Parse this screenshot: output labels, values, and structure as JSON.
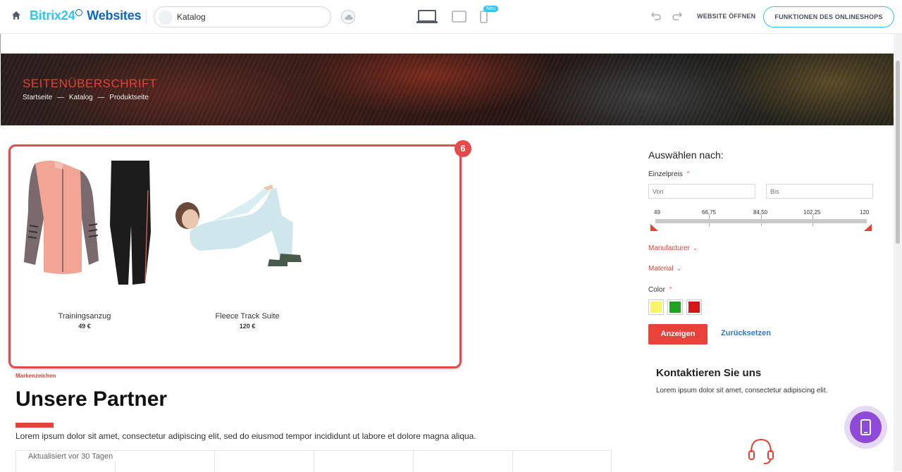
{
  "toolbar": {
    "brand_part1": "Bitrix24",
    "brand_part2": "Websites",
    "page_selector": "Katalog",
    "new_badge": "Neu",
    "open_site": "WEBSITE ÖFFNEN",
    "shop_features": "FUNKTIONEN DES ONLINESHOPS"
  },
  "hero": {
    "title": "SEITENÜBERSCHRIFT",
    "breadcrumb": [
      "Startseite",
      "—",
      "Katalog",
      "—",
      "Produktseite"
    ]
  },
  "catalog": {
    "block_badge": "6",
    "products": [
      {
        "name": "Trainingsanzug",
        "price": "49 €"
      },
      {
        "name": "Fleece Track Suite",
        "price": "120 €"
      }
    ]
  },
  "filter": {
    "title": "Auswählen nach:",
    "price_label": "Einzelpreis",
    "from_placeholder": "Von",
    "to_placeholder": "Bis",
    "slider_ticks": [
      "49",
      "66,75",
      "84,50",
      "102,25",
      "120"
    ],
    "manufacturer_label": "Manufacturer",
    "material_label": "Material",
    "color_label": "Color",
    "colors": [
      "#f7f565",
      "#1fa21f",
      "#d21818"
    ],
    "show_button": "Anzeigen",
    "reset_button": "Zurücksetzen"
  },
  "contact": {
    "title": "Kontaktieren Sie uns",
    "text": "Lorem ipsum dolor sit amet, consectetur adipiscing elit."
  },
  "partners": {
    "eyebrow": "Markenzeichen",
    "title": "Unsere Partner",
    "text": "Lorem ipsum dolor sit amet, consectetur adipiscing elit, sed do eiusmod tempor incididunt ut labore et dolore magna aliqua.",
    "updated": "Aktualisiert vor 30 Tagen"
  },
  "colors": {
    "accent_red": "#e34234",
    "brand_blue": "#0b66c3",
    "brand_cyan": "#2fc6f6",
    "fab_purple": "#8e49d6"
  }
}
